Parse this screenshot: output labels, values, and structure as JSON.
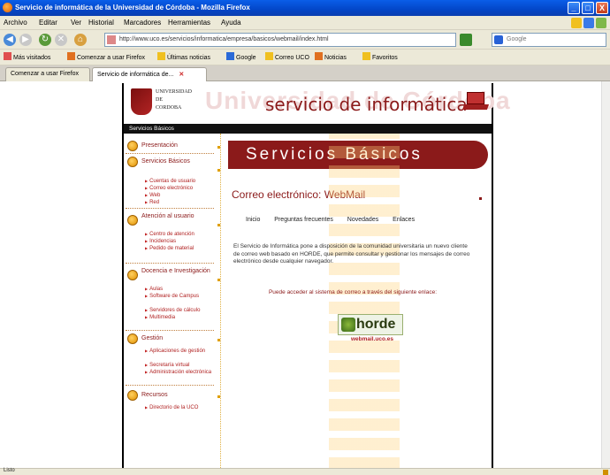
{
  "window": {
    "title": "Servicio de informática de la Universidad de Córdoba - Mozilla Firefox",
    "minimize_glyph": "_",
    "close_glyph": "X"
  },
  "menubar": {
    "items": [
      "Archivo",
      "Editar",
      "Ver",
      "Historial",
      "Marcadores",
      "Herramientas",
      "Ayuda"
    ]
  },
  "nav": {
    "url": "http://www.uco.es/servicios/informatica/empresa/basicos/webmail/index.html",
    "search_placeholder": "Google"
  },
  "bookmarks": {
    "items": [
      "Más visitados",
      "Comenzar a usar Firefox",
      "Últimas noticias",
      "Google",
      "Correo UCO",
      "Noticias",
      "Favoritos"
    ]
  },
  "tabs": [
    {
      "label": "Comenzar a usar Firefox",
      "active": false
    },
    {
      "label": "Servicio de informática de...",
      "active": true
    }
  ],
  "page": {
    "university": [
      "UNIVERSIDAD",
      "DE",
      "CORDOBA"
    ],
    "watermark": "Universidad de Córdoba",
    "site_title": "servicio de informática",
    "top_bar_label": "Servicios Básicos",
    "header": "Servicios Básicos",
    "section_title": "Correo electrónico: WebMail",
    "links": [
      "Inicio",
      "Preguntas frecuentes",
      "Novedades",
      "Enlaces"
    ],
    "paragraph": "El Servicio de Informática pone a disposición de la comunidad universitaria un nuevo cliente de correo web basado en HORDE, que permite consultar y gestionar los mensajes de correo electrónico desde cualquier navegador.",
    "paragraph2": "Puede acceder al sistema de correo a través del siguiente enlace:",
    "horde_label": "horde",
    "horde_caption": "webmail.uco.es"
  },
  "sidebar": {
    "sections": [
      {
        "title": "Presentación",
        "items": []
      },
      {
        "title": "Servicios Básicos",
        "items": [
          "Cuentas de usuario",
          "Correo electrónico",
          "Web",
          "Red"
        ]
      },
      {
        "title": "Atención al usuario",
        "items": [
          "Centro de atención",
          "Incidencias",
          "Pedido de material"
        ]
      },
      {
        "title": "Docencia e Investigación",
        "items": [
          "Aulas",
          "Software de Campus",
          "Servidores de cálculo",
          "Multimedia"
        ]
      },
      {
        "title": "Gestión",
        "items": [
          "Aplicaciones de gestión",
          "Secretaría virtual",
          "Administración electrónica"
        ]
      },
      {
        "title": "Recursos",
        "items": [
          "Directorio de la UCO"
        ]
      }
    ]
  },
  "statusbar": {
    "text": "Listo"
  },
  "colors": {
    "brand": "#8b1a1a",
    "titlebar": "#0346c8",
    "sidebar_accent": "#e0a000"
  }
}
